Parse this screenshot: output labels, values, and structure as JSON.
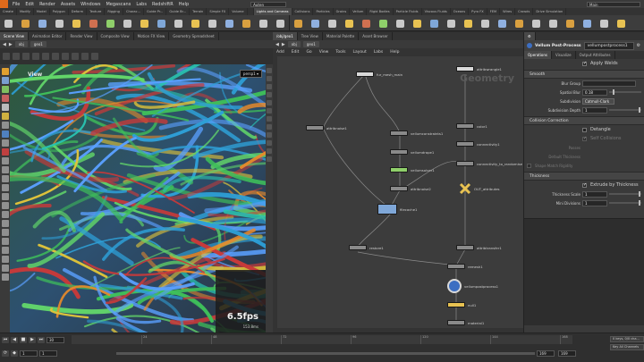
{
  "menubar": {
    "items": [
      "File",
      "Edit",
      "Render",
      "Assets",
      "Windows",
      "Megascans",
      "Labs",
      "RedshiftR",
      "Help"
    ],
    "build_label": "Auten",
    "desktop_label": "Main"
  },
  "shelf_tabs": [
    "Create",
    "Modify",
    "Model",
    "Polygon",
    "Deform",
    "Texture",
    "Rigging",
    "Charac...",
    "Guide Pr...",
    "Guide Br...",
    "Terrain",
    "Simple FX",
    "Volume",
    "",
    "Lights and Cameras",
    "Collisions",
    "Particles",
    "Grains",
    "Vellum",
    "Rigid Bodies",
    "Particle Fluids",
    "Viscous Fluids",
    "Oceans",
    "Pyro FX",
    "FEM",
    "Wires",
    "Crowds",
    "Drive Simulation"
  ],
  "shelf_tabs_active": 14,
  "viewport": {
    "tabs": [
      "Scene View",
      "Animation Editor",
      "Render View",
      "Composite View",
      "Motion FX View",
      "Geometry Spreadsheet"
    ],
    "active_tab": 0,
    "path": [
      "obj",
      "geo1"
    ],
    "view_label": "View",
    "camera": "persp1 ▾",
    "fps": "6.5fps",
    "fps_sub": "153.8ms"
  },
  "network": {
    "tabs": [
      "/obj/geo1",
      "Tree View",
      "Material Palette",
      "Asset Browser"
    ],
    "active_tab": 0,
    "path": [
      "obj",
      "geo1"
    ],
    "menu": [
      "Add",
      "Edit",
      "Go",
      "View",
      "Tools",
      "Layout",
      "Labs",
      "Help"
    ],
    "context_label": "Geometry",
    "nodes": [
      {
        "label": "fur_mesh_main"
      },
      {
        "label": "attribwrangle1"
      },
      {
        "label": "attribnoise1"
      },
      {
        "label": "vellumconstraints1"
      },
      {
        "label": "vellumdrape1"
      },
      {
        "label": "color1"
      },
      {
        "label": "connectivity1"
      },
      {
        "label": "vellumsolver1"
      },
      {
        "label": "connectivity_to_randomise"
      },
      {
        "label": "attribnoise2"
      },
      {
        "label": "OUT_attributes"
      },
      {
        "label": "filecache1"
      },
      {
        "label": "attribtransfer1"
      },
      {
        "label": "restore1"
      },
      {
        "label": "remesh1"
      },
      {
        "label": "vellumpostprocess1"
      },
      {
        "label": "null1"
      },
      {
        "label": "material1"
      }
    ]
  },
  "params": {
    "tabs": [
      "Operations",
      "Visualize",
      "Output Attributes"
    ],
    "node_type": "Vellum Post-Process",
    "node_name": "vellumpostprocess1",
    "apply_welds": "Apply Welds",
    "smooth_section": "Smooth",
    "blur_group_label": "Blur Group",
    "spatial_blur_label": "Spatial Blur",
    "spatial_blur_value": "0.18",
    "spatial_blur_level": 0.1,
    "subdivision_label": "Subdivision",
    "subdivision_value": "Catmull-Clark",
    "subdivision_depth_label": "Subdivision Depth",
    "subdivision_depth_value": "1",
    "subdivision_depth_level": 0.92,
    "collision_section": "Collision Correction",
    "detangle_label": "Detangle",
    "self_collisions_label": "Self Collisions",
    "passes_label": "Passes",
    "default_thickness_label": "Default Thickness",
    "shape_match_label": "Shape Match Rigidity",
    "thickness_section": "Thickness",
    "extrude_label": "Extrude by Thickness",
    "thickness_scale_label": "Thickness Scale",
    "thickness_scale_value": "1",
    "thickness_scale_level": 0.92,
    "min_divisions_label": "Mini Divisions",
    "min_divisions_value": "1",
    "min_divisions_level": 0.92
  },
  "timeline": {
    "current_frame": "30",
    "start_frame": "1",
    "end_frame_a": "1",
    "range_end": "169",
    "range_end_b": "169",
    "ticks": [
      "24",
      "48",
      "72",
      "96",
      "120",
      "144",
      "168"
    ],
    "keys_info": "0 keys, 0/0 cha...",
    "key_channels": "Key All Channels"
  },
  "colors": {
    "accent": "#e06a1b",
    "node_default": "#8a8a8a",
    "node_green": "#8fcf6a",
    "node_blue": "#7fa7d8",
    "node_yellow": "#e8c252",
    "node_white": "#d9d9d9"
  }
}
